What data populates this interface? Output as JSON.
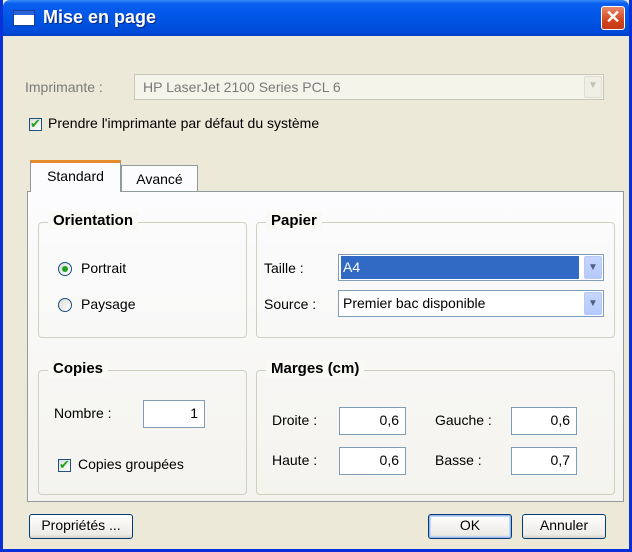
{
  "window": {
    "title": "Mise en page",
    "close_glyph": "✕"
  },
  "printer": {
    "label": "Imprimante :",
    "selected": "HP LaserJet 2100 Series PCL 6",
    "default_checkbox": {
      "label": "Prendre l'imprimante par défaut du système",
      "checked": true
    }
  },
  "tabs": [
    {
      "label": "Standard",
      "active": true
    },
    {
      "label": "Avancé",
      "active": false
    }
  ],
  "orientation": {
    "title": "Orientation",
    "options": [
      {
        "label": "Portrait",
        "selected": true
      },
      {
        "label": "Paysage",
        "selected": false
      }
    ]
  },
  "paper": {
    "title": "Papier",
    "size_label": "Taille :",
    "size_value": "A4",
    "source_label": "Source :",
    "source_value": "Premier bac disponible"
  },
  "copies": {
    "title": "Copies",
    "number_label": "Nombre :",
    "number_value": "1",
    "collate_label": "Copies groupées",
    "collate_checked": true
  },
  "margins": {
    "title": "Marges (cm)",
    "right_label": "Droite :",
    "right_value": "0,6",
    "left_label": "Gauche :",
    "left_value": "0,6",
    "top_label": "Haute :",
    "top_value": "0,6",
    "bottom_label": "Basse :",
    "bottom_value": "0,7"
  },
  "buttons": {
    "properties": "Propriétés ...",
    "ok": "OK",
    "cancel": "Annuler"
  },
  "icons": {
    "dropdown": "chevron-down-icon",
    "close": "close-icon",
    "window": "window-icon"
  },
  "colors": {
    "titlebar": "#0056e5",
    "accent_tab": "#e68b2c",
    "selection": "#316ac5",
    "check": "#21a121"
  }
}
